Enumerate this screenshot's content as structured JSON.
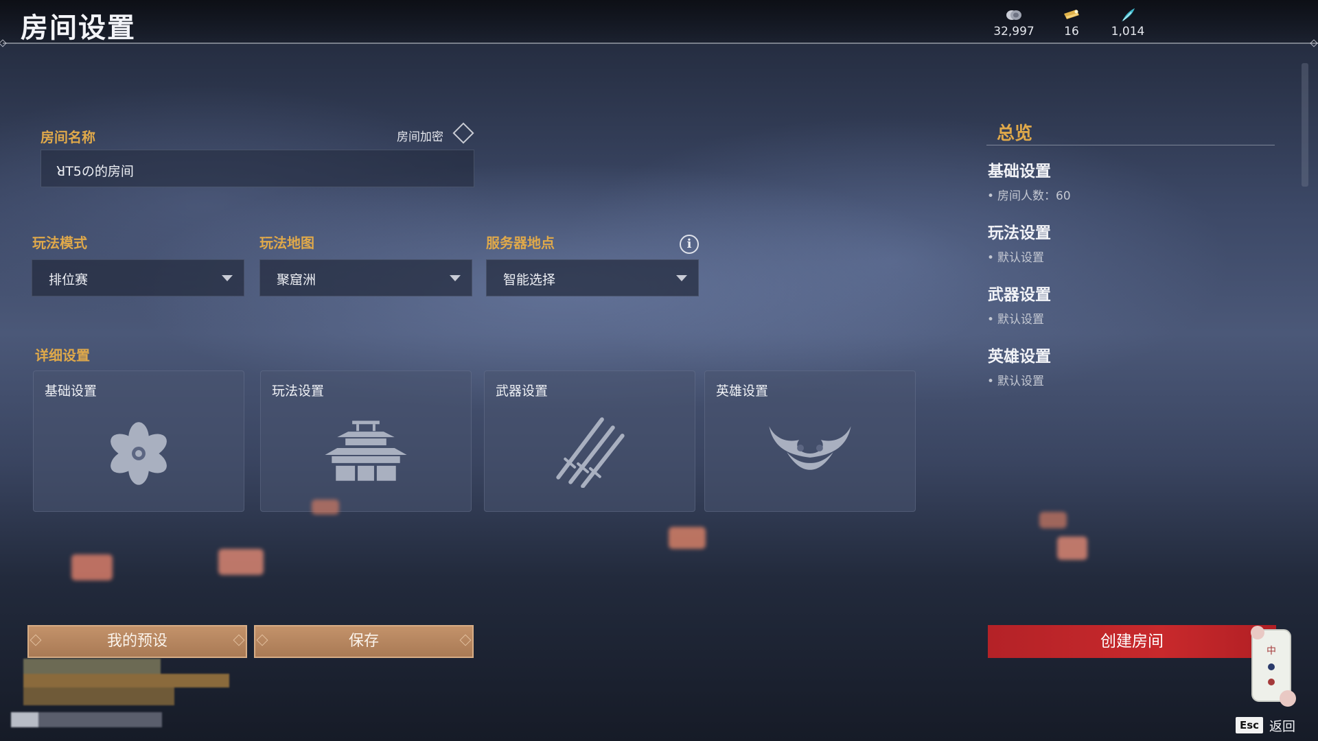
{
  "header": {
    "title": "房间设置",
    "currencies": [
      {
        "icon": "coin-stack-icon",
        "value": "32,997"
      },
      {
        "icon": "ticket-icon",
        "value": "16"
      },
      {
        "icon": "feather-icon",
        "value": "1,014"
      }
    ]
  },
  "room": {
    "name_label": "房间名称",
    "name_value": "ꓤT5の的房间",
    "encrypt_label": "房间加密"
  },
  "selects": {
    "mode": {
      "label": "玩法模式",
      "value": "排位赛"
    },
    "map": {
      "label": "玩法地图",
      "value": "聚窟洲"
    },
    "server": {
      "label": "服务器地点",
      "value": "智能选择"
    }
  },
  "details": {
    "label": "详细设置",
    "cards": [
      {
        "title": "基础设置",
        "icon": "flower-icon"
      },
      {
        "title": "玩法设置",
        "icon": "temple-icon"
      },
      {
        "title": "武器设置",
        "icon": "swords-icon"
      },
      {
        "title": "英雄设置",
        "icon": "demon-mask-icon"
      }
    ]
  },
  "overview": {
    "title": "总览",
    "sections": [
      {
        "title": "基础设置",
        "item": "房间人数：60"
      },
      {
        "title": "玩法设置",
        "item": "默认设置"
      },
      {
        "title": "武器设置",
        "item": "默认设置"
      },
      {
        "title": "英雄设置",
        "item": "默认设置"
      }
    ]
  },
  "buttons": {
    "presets": "我的预设",
    "save": "保存",
    "create": "创建房间"
  },
  "footer": {
    "esc_key": "Esc",
    "back_label": "返回"
  },
  "colors": {
    "accent_gold": "#e0a94a",
    "create_red": "#c8292c",
    "button_tan": "#b98a62"
  }
}
